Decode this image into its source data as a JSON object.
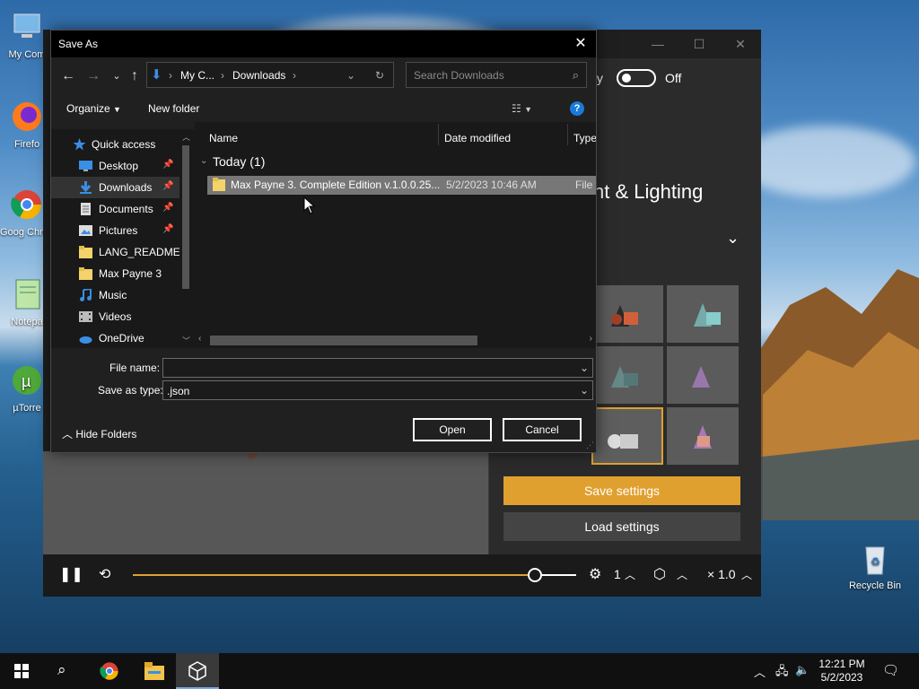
{
  "desktop": {
    "icons": [
      {
        "label": "My Com"
      },
      {
        "label": "Firefo"
      },
      {
        "label": "Goog Chron"
      },
      {
        "label": "Notepa"
      },
      {
        "label": "µTorre"
      },
      {
        "label": "Recycle Bin"
      }
    ]
  },
  "app": {
    "privacy_tail": "ty",
    "toggle_state": "Off",
    "section_title": "nt & Lighting",
    "save_settings": "Save settings",
    "load_settings": "Load settings",
    "speed_value": "1",
    "zoom_value": "× 1.0",
    "progress_fraction": 0.906,
    "accent_color": "#e0a030"
  },
  "dialog": {
    "title": "Save As",
    "address": {
      "seg1": "My C...",
      "seg2": "Downloads"
    },
    "search_placeholder": "Search Downloads",
    "toolbar": {
      "organize": "Organize",
      "new_folder": "New folder"
    },
    "nav": [
      {
        "label": "Quick access",
        "icon": "star-icon",
        "pinned": false
      },
      {
        "label": "Desktop",
        "icon": "desktop-icon",
        "pinned": true
      },
      {
        "label": "Downloads",
        "icon": "download-icon",
        "pinned": true
      },
      {
        "label": "Documents",
        "icon": "documents-icon",
        "pinned": true
      },
      {
        "label": "Pictures",
        "icon": "pictures-icon",
        "pinned": true
      },
      {
        "label": "LANG_README",
        "icon": "folder-icon",
        "pinned": false
      },
      {
        "label": "Max Payne 3",
        "icon": "folder-icon",
        "pinned": false
      },
      {
        "label": "Music",
        "icon": "music-icon",
        "pinned": false
      },
      {
        "label": "Videos",
        "icon": "videos-icon",
        "pinned": false
      },
      {
        "label": "OneDrive",
        "icon": "cloud-icon",
        "pinned": false
      }
    ],
    "columns": {
      "name": "Name",
      "date": "Date modified",
      "type": "Type"
    },
    "group": "Today (1)",
    "files": [
      {
        "name": "Max Payne 3. Complete Edition v.1.0.0.25...",
        "date": "5/2/2023 10:46 AM",
        "type": "File fo"
      }
    ],
    "file_name_label": "File name:",
    "file_name_value": "",
    "save_type_label": "Save as type:",
    "save_type_value": ".json",
    "hide_folders": "Hide Folders",
    "open": "Open",
    "cancel": "Cancel"
  },
  "taskbar": {
    "time": "12:21 PM",
    "date": "5/2/2023"
  }
}
